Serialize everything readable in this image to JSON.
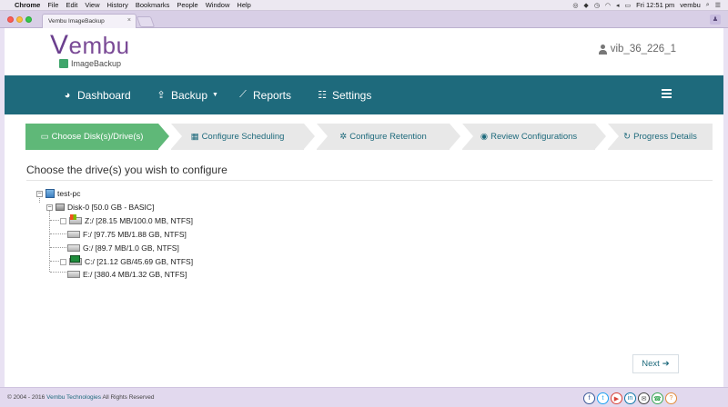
{
  "menubar": {
    "apple": "",
    "items": [
      "Chrome",
      "File",
      "Edit",
      "View",
      "History",
      "Bookmarks",
      "People",
      "Window",
      "Help"
    ],
    "clock": "Fri 12:51 pm",
    "user": "vembu"
  },
  "browser": {
    "tab_title": "Vembu ImageBackup"
  },
  "header": {
    "logo_word_initial": "V",
    "logo_word_rest": "embu",
    "logo_sub": "ImageBackup",
    "user": "vib_36_226_1"
  },
  "nav": {
    "dashboard": "Dashboard",
    "backup": "Backup",
    "reports": "Reports",
    "settings": "Settings"
  },
  "steps": [
    {
      "label": "Choose Disk(s)/Drive(s)",
      "active": true
    },
    {
      "label": "Configure Scheduling",
      "active": false
    },
    {
      "label": "Configure Retention",
      "active": false
    },
    {
      "label": "Review Configurations",
      "active": false
    },
    {
      "label": "Progress Details",
      "active": false
    }
  ],
  "main": {
    "title": "Choose the drive(s) you wish to configure"
  },
  "tree": {
    "root": "test-pc",
    "disk": "Disk-0 [50.0 GB - BASIC]",
    "drives": [
      "Z:/ [28.15 MB/100.0 MB, NTFS]",
      "F:/ [97.75 MB/1.88 GB, NTFS]",
      "G:/ [89.7 MB/1.0 GB, NTFS]",
      "C:/ [21.12 GB/45.69 GB, NTFS]",
      "E:/ [380.4 MB/1.32 GB, NTFS]"
    ]
  },
  "actions": {
    "next": "Next"
  },
  "footer": {
    "copyright_prefix": "© 2004 - 2016",
    "company": "Vembu Technologies",
    "rights": "All Rights Reserved"
  },
  "colors": {
    "nav_bg": "#1e6a7c",
    "step_active": "#5fb878",
    "step_inactive": "#e8e8e8",
    "brand_purple": "#7a4a96"
  }
}
